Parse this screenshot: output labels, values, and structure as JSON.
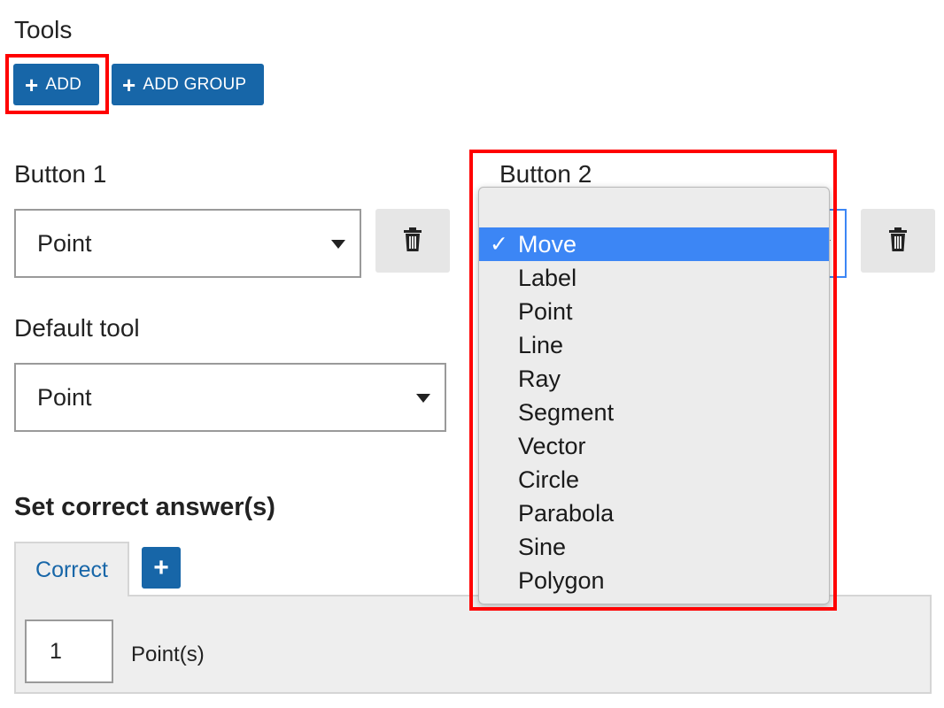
{
  "tools": {
    "title": "Tools",
    "add_label": "ADD",
    "add_group_label": "ADD GROUP"
  },
  "button1": {
    "label": "Button 1",
    "value": "Point"
  },
  "button2": {
    "label": "Button 2"
  },
  "default_tool": {
    "label": "Default tool",
    "value": "Point"
  },
  "dropdown": {
    "check": "✓",
    "options": [
      "Move",
      "Label",
      "Point",
      "Line",
      "Ray",
      "Segment",
      "Vector",
      "Circle",
      "Parabola",
      "Sine",
      "Polygon"
    ],
    "selected": "Move"
  },
  "answers": {
    "heading": "Set correct answer(s)",
    "tab_label": "Correct",
    "add_tab": "+",
    "points_value": "1",
    "points_label": "Point(s)"
  },
  "colors": {
    "accent": "#1766a8",
    "highlight": "#3c86f5",
    "annotation": "#ff0000"
  }
}
